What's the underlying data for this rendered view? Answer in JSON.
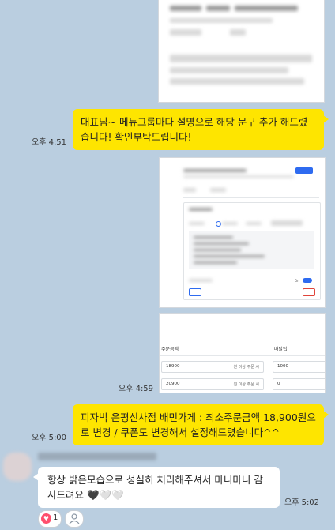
{
  "messages": [
    {
      "text": "대표님~ 메뉴그룹마다 설명으로 해당 문구 추가 해드렸습니다! 확인부탁드립니다!",
      "time": "오후 4:51"
    },
    {
      "time": "오후 4:59"
    },
    {
      "text": "피자빅 은평신사점 배민가게 : 최소주문금액 18,900원으로 변경 / 쿠폰도 변경해서 설정해드렸습니다^^",
      "time": "오후 5:00"
    },
    {
      "text": "항상 밝은모습으로 성실히 처리해주셔서 마니마니 감사드려요 🖤🤍🤍",
      "time": "오후 5:02"
    }
  ],
  "reaction": {
    "count": "1",
    "icon": "heart-icon"
  },
  "screenshot_b": {
    "on_label": "On"
  },
  "screenshot_c": {
    "col_amount": "주문금액",
    "col_delivery": "배달팁",
    "rows": [
      {
        "amount": "18900",
        "suffix": "원 이상 주문 시",
        "tip": "1000"
      },
      {
        "amount": "20900",
        "suffix": "원 이상 주문 시",
        "tip": "0"
      }
    ]
  },
  "colors": {
    "background": "#bacee0",
    "mine": "#fee500",
    "theirs": "#ffffff",
    "accent": "#2e6bf0"
  }
}
